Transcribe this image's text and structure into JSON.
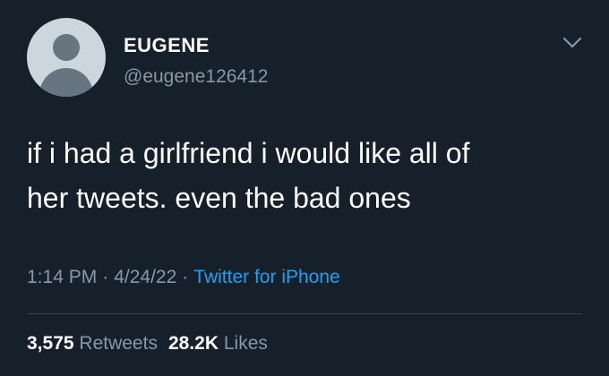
{
  "tweet": {
    "display_name": "EUGENE",
    "handle": "@eugene126412",
    "text": "if i had a girlfriend i would like all of\nher tweets. even the bad ones",
    "time": "1:14 PM",
    "date": "4/24/22",
    "separator": "·",
    "source": "Twitter for iPhone",
    "retweets": {
      "count": "3,575",
      "label": "Retweets"
    },
    "likes": {
      "count": "28.2K",
      "label": "Likes"
    }
  },
  "icons": {
    "avatar": "default-avatar-icon",
    "menu": "chevron-down-icon"
  },
  "colors": {
    "background": "#15202b",
    "primary_text": "#ffffff",
    "secondary_text": "#8899a6",
    "link": "#1da1f2",
    "divider": "#38444d"
  }
}
